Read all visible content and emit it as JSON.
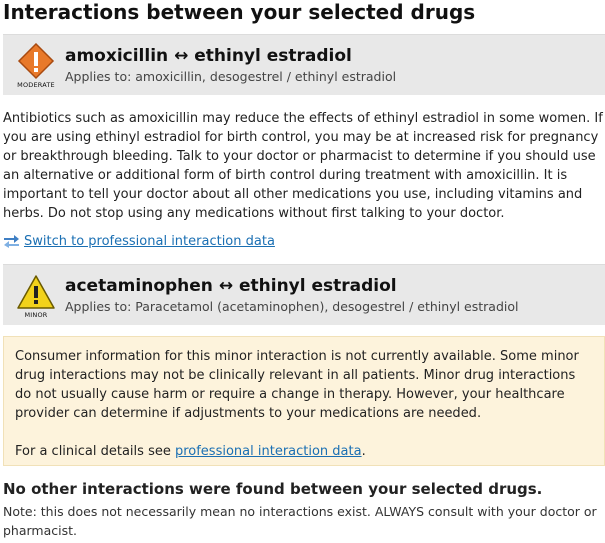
{
  "page": {
    "title": "Interactions between your selected drugs"
  },
  "interactions": [
    {
      "severity": "MODERATE",
      "severity_icon": "moderate-severity-warning-icon",
      "severity_color": "#e8792a",
      "title": "amoxicillin ↔ ethinyl estradiol",
      "applies_to": "Applies to: amoxicillin, desogestrel / ethinyl estradiol",
      "description": "Antibiotics such as amoxicillin may reduce the effects of ethinyl estradiol in some women. If you are using ethinyl estradiol for birth control, you may be at increased risk for pregnancy or breakthrough bleeding. Talk to your doctor or pharmacist to determine if you should use an alternative or additional form of birth control during treatment with amoxicillin. It is important to tell your doctor about all other medications you use, including vitamins and herbs. Do not stop using any medications without first talking to your doctor.",
      "switch_link": "Switch to professional interaction data"
    },
    {
      "severity": "MINOR",
      "severity_icon": "minor-severity-warning-icon",
      "severity_color": "#f2d21b",
      "title": "acetaminophen ↔ ethinyl estradiol",
      "applies_to": "Applies to: Paracetamol (acetaminophen), desogestrel / ethinyl estradiol",
      "notice": "Consumer information for this minor interaction is not currently available. Some minor drug interactions may not be clinically relevant in all patients. Minor drug interactions do not usually cause harm or require a change in therapy. However, your healthcare provider can determine if adjustments to your medications are needed.",
      "clinical_prefix": "For a clinical details see ",
      "clinical_link": "professional interaction data",
      "clinical_suffix": "."
    }
  ],
  "footer": {
    "none_found": "No other interactions were found between your selected drugs.",
    "note": "Note: this does not necessarily mean no interactions exist. ALWAYS consult with your doctor or pharmacist."
  },
  "colors": {
    "link": "#1a6fb3",
    "header_bg": "#e8e8e8",
    "notice_bg": "#fdf3dc"
  }
}
